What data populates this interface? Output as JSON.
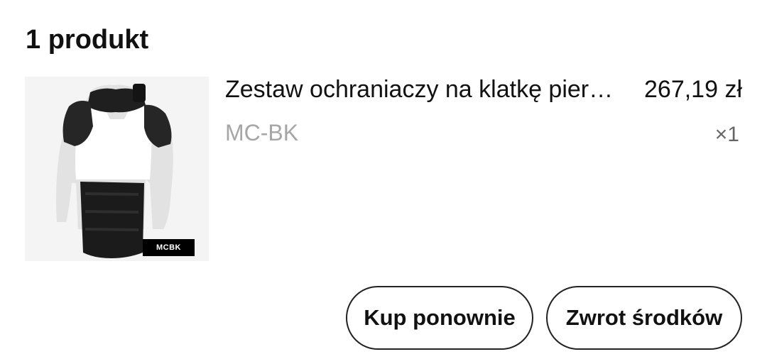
{
  "order": {
    "count_title": "1 produkt"
  },
  "product": {
    "name": "Zestaw ochraniaczy na klatkę piersiową i ramiona taktyczne",
    "price": "267,19 zł",
    "variant": "MC-BK",
    "quantity": "×1",
    "image": {
      "icon": "tactical-vest-image",
      "tag_text": "MCBK"
    }
  },
  "actions": {
    "buy_again_label": "Kup ponownie",
    "refund_label": "Zwrot środków"
  },
  "colors": {
    "text_primary": "#111111",
    "text_secondary": "#a6a6a6",
    "button_border": "#222222"
  }
}
